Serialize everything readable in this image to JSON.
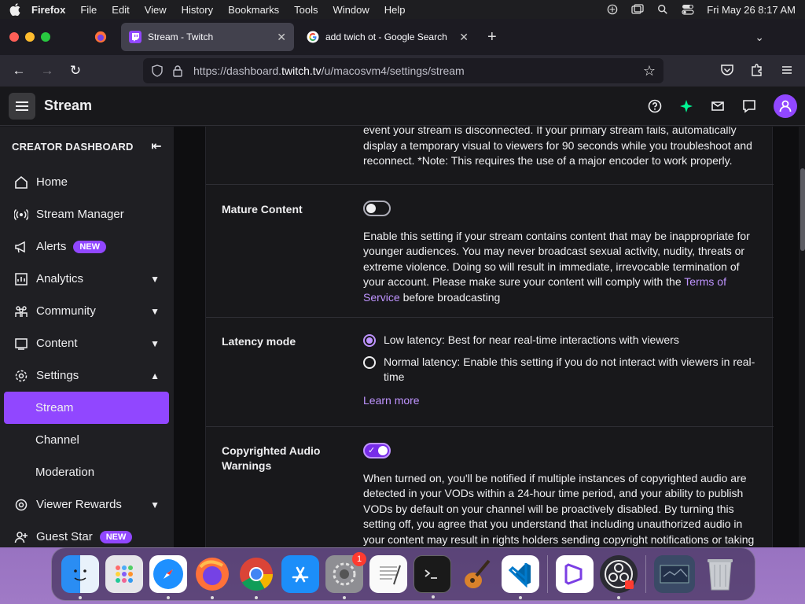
{
  "menubar": {
    "app_name": "Firefox",
    "items": [
      "File",
      "Edit",
      "View",
      "History",
      "Bookmarks",
      "Tools",
      "Window",
      "Help"
    ],
    "clock": "Fri May 26  8:17 AM"
  },
  "browser": {
    "tabs": [
      {
        "title": "Stream - Twitch",
        "favicon": "twitch-icon",
        "active": true
      },
      {
        "title": "add twich ot - Google Search",
        "favicon": "google-icon",
        "active": false
      }
    ],
    "url_prefix": "https://dashboard.",
    "url_domain": "twitch.tv",
    "url_path": "/u/macosvm4/settings/stream"
  },
  "header": {
    "title": "Stream"
  },
  "sidebar": {
    "heading": "CREATOR DASHBOARD",
    "items": [
      {
        "label": "Home",
        "icon": "home-icon"
      },
      {
        "label": "Stream Manager",
        "icon": "broadcast-icon"
      },
      {
        "label": "Alerts",
        "icon": "megaphone-icon",
        "badge": "NEW"
      },
      {
        "label": "Analytics",
        "icon": "analytics-icon",
        "expandable": true
      },
      {
        "label": "Community",
        "icon": "community-icon",
        "expandable": true
      },
      {
        "label": "Content",
        "icon": "content-icon",
        "expandable": true
      },
      {
        "label": "Settings",
        "icon": "gear-icon",
        "expanded": true
      },
      {
        "label": "Stream",
        "active": true
      },
      {
        "label": "Channel"
      },
      {
        "label": "Moderation"
      },
      {
        "label": "Viewer Rewards",
        "icon": "rewards-icon",
        "expandable": true
      },
      {
        "label": "Guest Star",
        "icon": "add-user-icon",
        "badge": "NEW"
      }
    ]
  },
  "settings": {
    "disconnect_text": "event your stream is disconnected. If your primary stream fails, automatically display a temporary visual to viewers for 90 seconds while you troubleshoot and reconnect. *Note: This requires the use of a major encoder to work properly.",
    "mature": {
      "label": "Mature Content",
      "enabled": false,
      "text": "Enable this setting if your stream contains content that may be inappropriate for younger audiences. You may never broadcast sexual activity, nudity, threats or extreme violence. Doing so will result in immediate, irrevocable termination of your account. Please make sure your content will comply with the",
      "link": "Terms of Service",
      "text_after": "before broadcasting"
    },
    "latency": {
      "label": "Latency mode",
      "options": [
        {
          "label": "Low latency: Best for near real-time interactions with viewers",
          "selected": true
        },
        {
          "label": "Normal latency: Enable this setting if you do not interact with viewers in real-time",
          "selected": false
        }
      ],
      "learn_more": "Learn more"
    },
    "copyright": {
      "label": "Copyrighted Audio Warnings",
      "enabled": true,
      "text": "When turned on, you'll be notified if multiple instances of copyrighted audio are detected in your VODs within a 24-hour time period, and your ability to publish VODs by default on your channel will be proactively disabled. By turning this setting off, you agree that you understand that including unauthorized audio in your content may result in rights holders sending copyright notifications or taking"
    }
  },
  "dock": {
    "apps": [
      "finder-icon",
      "launchpad-icon",
      "safari-icon",
      "firefox-icon",
      "chrome-icon",
      "app-store-icon",
      "system-settings-icon",
      "textedit-icon",
      "terminal-icon",
      "garageband-icon",
      "vscode-icon",
      "visual-studio-icon",
      "obs-icon",
      "screenshot-icon",
      "trash-icon"
    ],
    "settings_badge": "1"
  }
}
